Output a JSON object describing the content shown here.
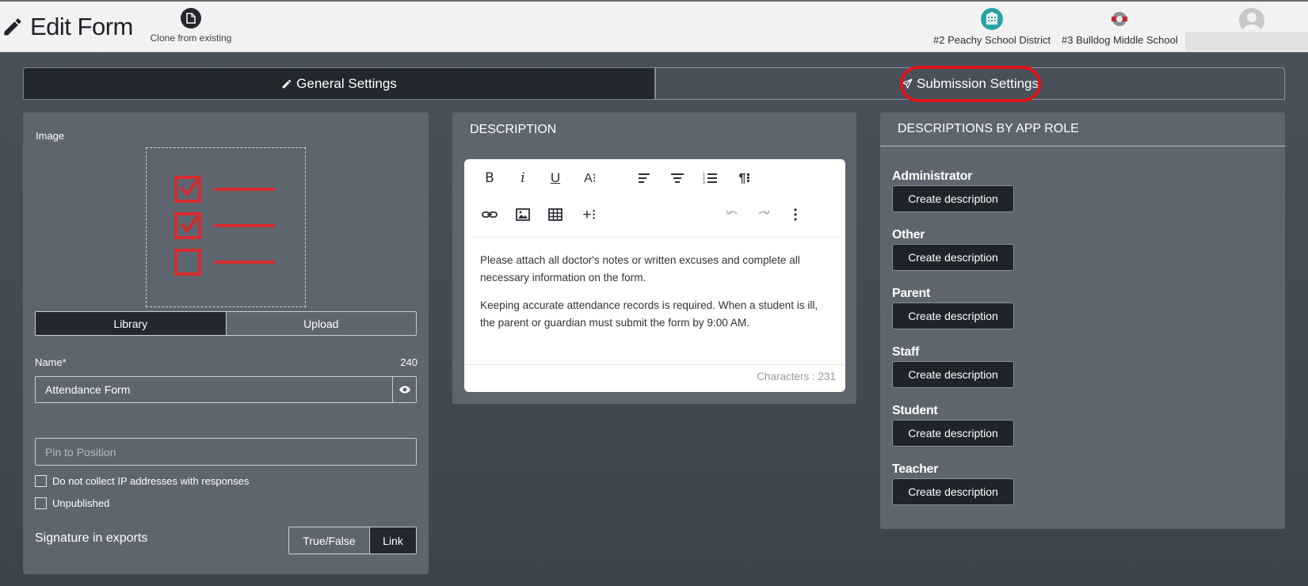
{
  "header": {
    "title": "Edit Form",
    "clone_label": "Clone from existing",
    "district_label": "#2 Peachy School District",
    "school_label": "#3 Bulldog Middle School"
  },
  "tabs": {
    "general": "General Settings",
    "submission": "Submission Settings"
  },
  "image_section": {
    "label": "Image",
    "library": "Library",
    "upload": "Upload"
  },
  "name_field": {
    "label": "Name*",
    "count": "240",
    "value": "Attendance Form"
  },
  "pin_field": {
    "placeholder": "Pin to Position"
  },
  "checkboxes": {
    "no_ip": "Do not collect IP addresses with responses",
    "unpublished": "Unpublished"
  },
  "signature": {
    "label": "Signature in exports",
    "true_false": "True/False",
    "link": "Link"
  },
  "description": {
    "heading": "DESCRIPTION",
    "paragraph1": "Please attach all doctor's notes or written excuses and complete all necessary information on the form.",
    "paragraph2": "Keeping accurate attendance records is required. When a student is ill, the parent or guardian must submit the form by 9:00 AM.",
    "char_count": "Characters : 231"
  },
  "roles": {
    "heading": "DESCRIPTIONS BY APP ROLE",
    "button_label": "Create description",
    "items": [
      "Administrator",
      "Other",
      "Parent",
      "Staff",
      "Student",
      "Teacher"
    ]
  },
  "colors": {
    "highlight": "#e0141d",
    "checklist_red": "#d42a2e",
    "dark": "#23282f"
  }
}
